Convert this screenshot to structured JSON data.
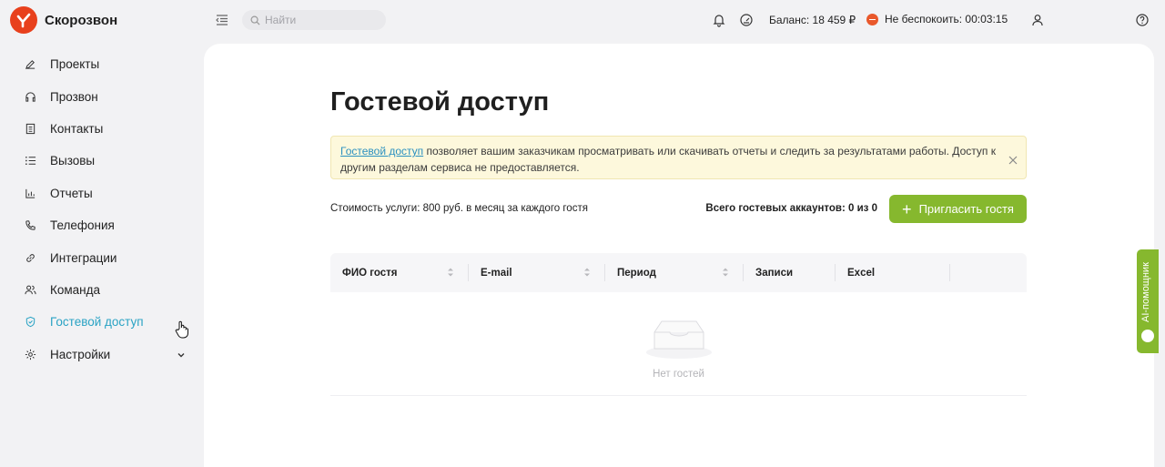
{
  "app": {
    "name": "Скорозвон",
    "brand_color": "#e8401c",
    "accent_color": "#86b82e",
    "active_color": "#2aa3c4"
  },
  "header": {
    "search_placeholder": "Найти",
    "balance": "Баланс: 18 459 ₽",
    "dnd": "Не беспокоить: 00:03:15"
  },
  "sidebar": {
    "items": [
      {
        "label": "Проекты",
        "icon": "pencil-icon"
      },
      {
        "label": "Прозвон",
        "icon": "headset-icon"
      },
      {
        "label": "Контакты",
        "icon": "contacts-book-icon"
      },
      {
        "label": "Вызовы",
        "icon": "list-icon"
      },
      {
        "label": "Отчеты",
        "icon": "bar-chart-icon"
      },
      {
        "label": "Телефония",
        "icon": "phone-icon"
      },
      {
        "label": "Интеграции",
        "icon": "link-icon"
      },
      {
        "label": "Команда",
        "icon": "team-icon"
      },
      {
        "label": "Гостевой доступ",
        "icon": "shield-check-icon",
        "active": true
      },
      {
        "label": "Настройки",
        "icon": "gear-icon",
        "expandable": true
      }
    ]
  },
  "page": {
    "title": "Гостевой доступ",
    "notice_link": "Гостевой доступ",
    "notice_text": " позволяет вашим заказчикам просматривать или скачивать отчеты и следить за результатами работы. Доступ к другим разделам сервиса не предоставляется.",
    "cost": "Стоимость услуги: 800 руб. в месяц за каждого гостя",
    "total": "Всего гостевых аккаунтов: 0 из 0",
    "invite_button": "Пригласить гостя",
    "table": {
      "columns": [
        "ФИО гостя",
        "E-mail",
        "Период",
        "Записи",
        "Excel"
      ],
      "empty_text": "Нет гостей"
    }
  },
  "ai_assistant": {
    "label": "AI-помощник"
  }
}
